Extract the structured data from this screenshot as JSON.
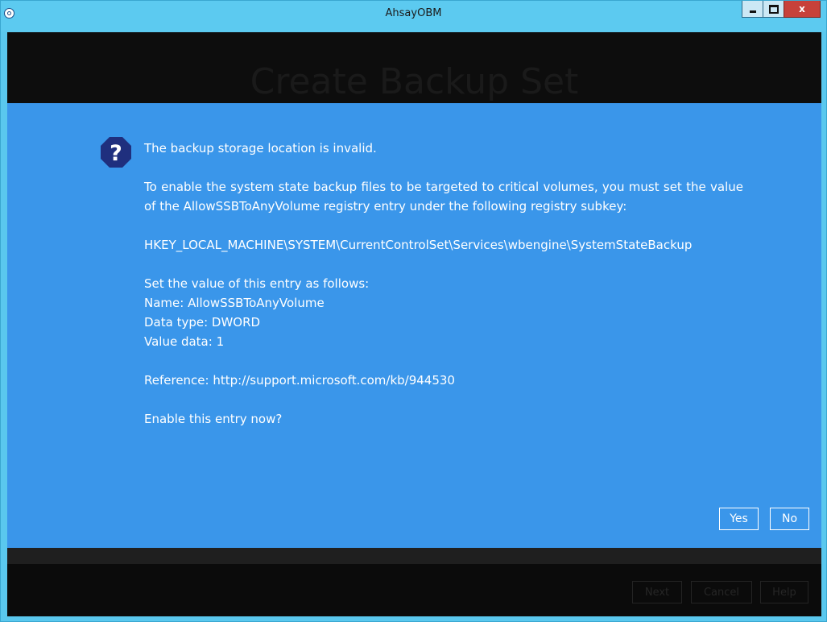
{
  "window": {
    "title": "AhsayOBM",
    "minimize_label": "",
    "maximize_label": "",
    "close_label": "x"
  },
  "background": {
    "page_title": "Create Backup Set",
    "buttons": {
      "next": "Next",
      "cancel": "Cancel",
      "help": "Help"
    }
  },
  "dialog": {
    "icon": "question-icon",
    "heading": "The backup storage location is invalid.",
    "explanation": "To enable the system state backup files to be targeted to critical volumes, you must set the value of the AllowSSBToAnyVolume registry entry under the following registry subkey:",
    "registry_path": "HKEY_LOCAL_MACHINE\\SYSTEM\\CurrentControlSet\\Services\\wbengine\\SystemStateBackup",
    "set_value_intro": "Set the value of this entry as follows:",
    "entry_name": "Name: AllowSSBToAnyVolume",
    "data_type": "Data type: DWORD",
    "value_data": "Value data: 1",
    "reference": "Reference: http://support.microsoft.com/kb/944530",
    "question": "Enable this entry now?",
    "yes_label": "Yes",
    "no_label": "No"
  },
  "colors": {
    "titlebar": "#5ccaf0",
    "dialog_bg": "#3a96ea",
    "close_button": "#c7413a",
    "overlay": "#0d0d0d"
  }
}
